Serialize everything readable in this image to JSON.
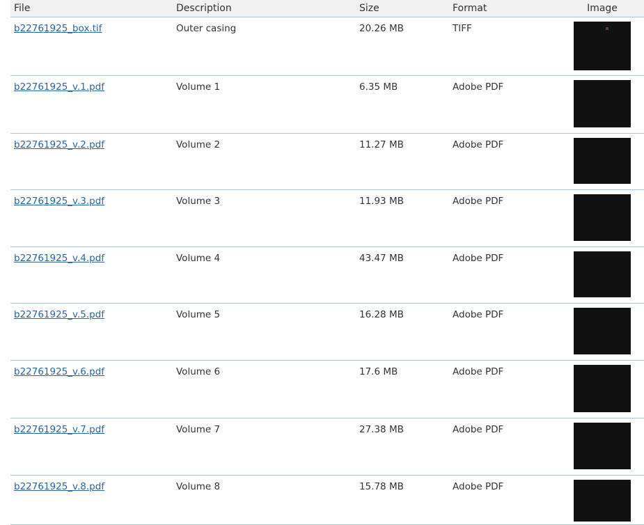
{
  "table": {
    "headers": {
      "file": "File",
      "description": "Description",
      "size": "Size",
      "format": "Format",
      "image": "Image"
    },
    "rows": [
      {
        "file": "b22761925_box.tif",
        "description": "Outer casing",
        "size": "20.26 MB",
        "format": "TIFF"
      },
      {
        "file": "b22761925_v.1.pdf",
        "description": "Volume 1",
        "size": "6.35 MB",
        "format": "Adobe PDF"
      },
      {
        "file": "b22761925_v.2.pdf",
        "description": "Volume 2",
        "size": "11.27 MB",
        "format": "Adobe PDF"
      },
      {
        "file": "b22761925_v.3.pdf",
        "description": "Volume 3",
        "size": "11.93 MB",
        "format": "Adobe PDF"
      },
      {
        "file": "b22761925_v.4.pdf",
        "description": "Volume 4",
        "size": "43.47 MB",
        "format": "Adobe PDF"
      },
      {
        "file": "b22761925_v.5.pdf",
        "description": "Volume 5",
        "size": "16.28 MB",
        "format": "Adobe PDF"
      },
      {
        "file": "b22761925_v.6.pdf",
        "description": "Volume 6",
        "size": "17.6 MB",
        "format": "Adobe PDF"
      },
      {
        "file": "b22761925_v.7.pdf",
        "description": "Volume 7",
        "size": "27.38 MB",
        "format": "Adobe PDF"
      },
      {
        "file": "b22761925_v.8.pdf",
        "description": "Volume 8",
        "size": "15.78 MB",
        "format": "Adobe PDF"
      }
    ]
  },
  "colors": {
    "link": "#2a65a0",
    "row_divider": "#a9c4d8",
    "header_bg": "#f1f1f1",
    "thumbnail_frame": "#111111"
  }
}
